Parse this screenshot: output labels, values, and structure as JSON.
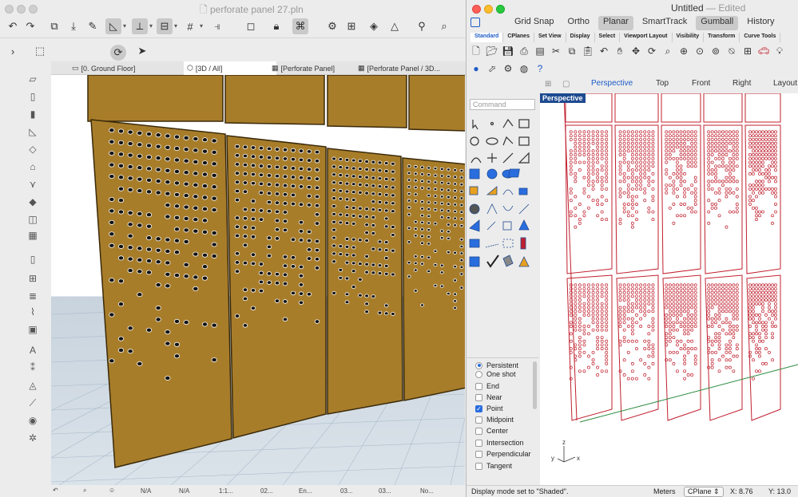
{
  "archicad": {
    "title": "perforate panel 27.pln",
    "tabs": [
      {
        "label": "[0. Ground Floor]",
        "icon": "floorplan-icon"
      },
      {
        "label": "[3D / All]",
        "icon": "cube-icon"
      },
      {
        "label": "[Perforate Panel]",
        "icon": "section-icon"
      },
      {
        "label": "[Perforate Panel / 3D...",
        "icon": "section-icon"
      }
    ],
    "status": {
      "scale": "1:1...",
      "layer": "02...",
      "pen": "En...",
      "set1": "03...",
      "set2": "03...",
      "model": "No...",
      "na1": "N/A",
      "na2": "N/A"
    }
  },
  "rhino": {
    "title": "Untitled",
    "edited": "— Edited",
    "toggles": [
      "Grid Snap",
      "Ortho",
      "Planar",
      "SmartTrack",
      "Gumball",
      "History"
    ],
    "active_toggles": [
      "Planar",
      "Gumball"
    ],
    "toolbar_tabs": [
      "Standard",
      "CPlanes",
      "Set View",
      "Display",
      "Select",
      "Viewport Layout",
      "Visibility",
      "Transform",
      "Curve Tools"
    ],
    "command_placeholder": "Command",
    "viewport_tabs": [
      "Perspective",
      "Top",
      "Front",
      "Right",
      "Layout"
    ],
    "viewport_label": "Perspective",
    "snaps": [
      {
        "label": "Persistent",
        "kind": "radio",
        "on": true
      },
      {
        "label": "One shot",
        "kind": "radio",
        "on": false
      },
      {
        "label": "End",
        "kind": "check",
        "on": false
      },
      {
        "label": "Near",
        "kind": "check",
        "on": false
      },
      {
        "label": "Point",
        "kind": "check",
        "on": true
      },
      {
        "label": "Midpoint",
        "kind": "check",
        "on": false
      },
      {
        "label": "Center",
        "kind": "check",
        "on": false
      },
      {
        "label": "Intersection",
        "kind": "check",
        "on": false
      },
      {
        "label": "Perpendicular",
        "kind": "check",
        "on": false
      },
      {
        "label": "Tangent",
        "kind": "check",
        "on": false
      }
    ],
    "status_message": "Display mode set to \"Shaded\".",
    "units": "Meters",
    "cplane": "CPlane",
    "x_coord": "X: 8.76",
    "y_coord": "Y: 13.0",
    "axis": {
      "x": "x",
      "y": "y",
      "z": "z"
    }
  },
  "colors": {
    "panel": "#a87d2a",
    "panel_edge": "#3a2a0a",
    "wire": "#c0202e",
    "accent": "#1e5bc6"
  }
}
